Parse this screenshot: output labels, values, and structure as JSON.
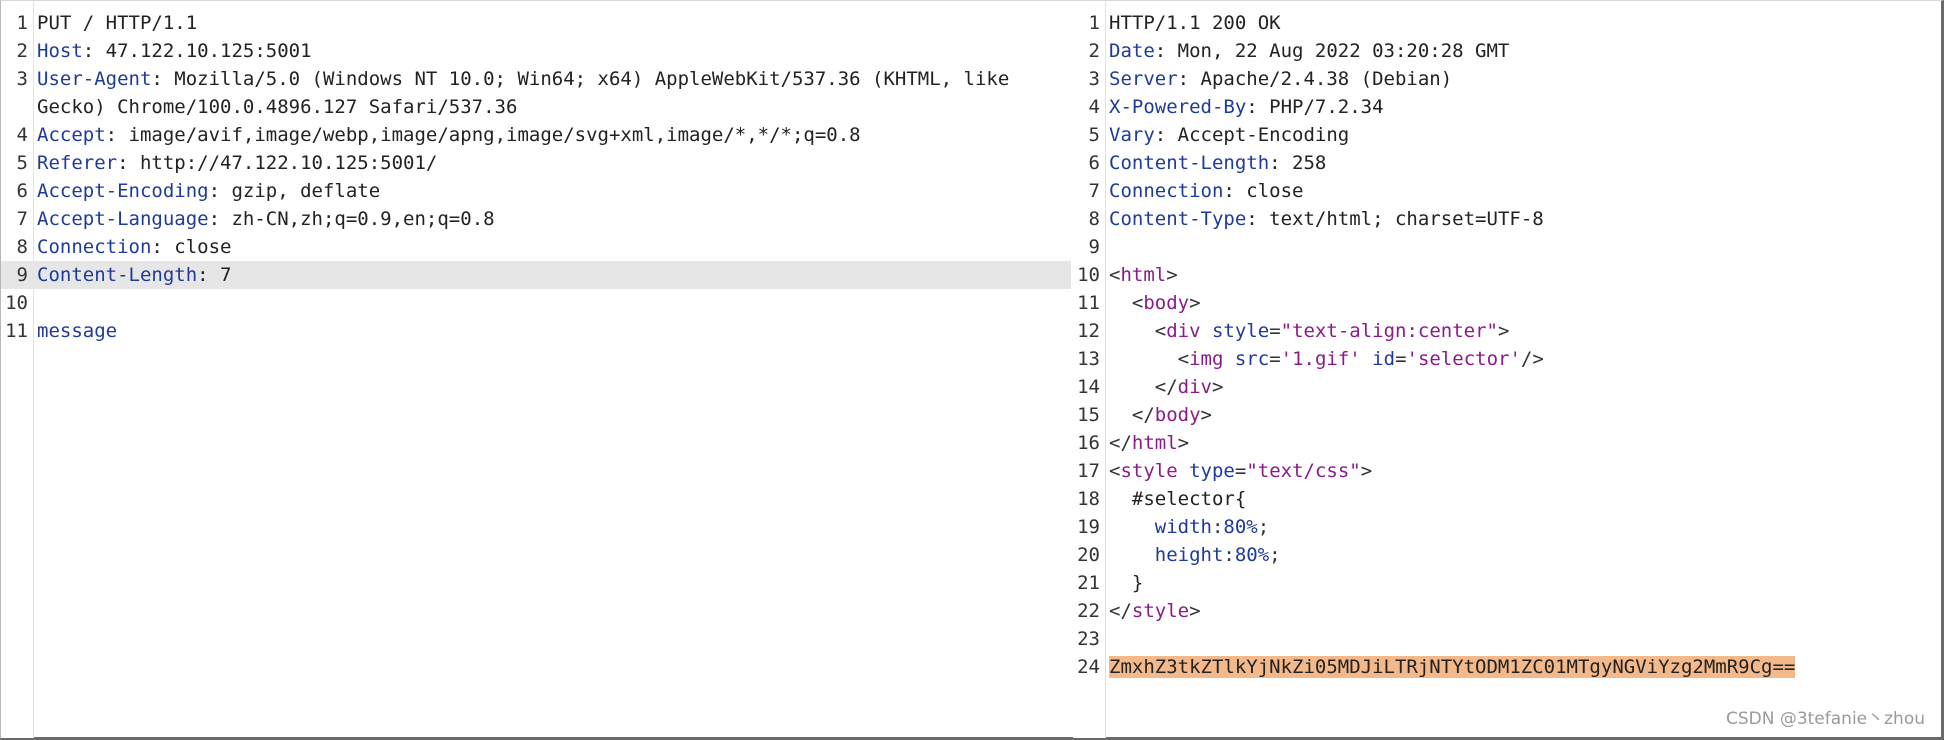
{
  "request": {
    "lines": [
      {
        "n": "1",
        "segs": [
          {
            "t": "PUT / HTTP/1.1",
            "c": ""
          }
        ]
      },
      {
        "n": "2",
        "segs": [
          {
            "t": "Host",
            "c": "hk"
          },
          {
            "t": ": 47.122.10.125:5001",
            "c": ""
          }
        ]
      },
      {
        "n": "3",
        "wrap": true,
        "segs": [
          {
            "t": "User-Agent",
            "c": "hk"
          },
          {
            "t": ": Mozilla/5.0 (Windows NT 10.0; Win64; x64) AppleWebKit/537.36 (KHTML, like Gecko) Chrome/100.0.4896.127 Safari/537.36",
            "c": ""
          }
        ]
      },
      {
        "n": "4",
        "segs": [
          {
            "t": "Accept",
            "c": "hk"
          },
          {
            "t": ": image/avif,image/webp,image/apng,image/svg+xml,image/*,*/*;q=0.8",
            "c": ""
          }
        ]
      },
      {
        "n": "5",
        "segs": [
          {
            "t": "Referer",
            "c": "hk"
          },
          {
            "t": ": http://47.122.10.125:5001/",
            "c": ""
          }
        ]
      },
      {
        "n": "6",
        "segs": [
          {
            "t": "Accept-Encoding",
            "c": "hk"
          },
          {
            "t": ": gzip, deflate",
            "c": ""
          }
        ]
      },
      {
        "n": "7",
        "segs": [
          {
            "t": "Accept-Language",
            "c": "hk"
          },
          {
            "t": ": zh-CN,zh;q=0.9,en;q=0.8",
            "c": ""
          }
        ]
      },
      {
        "n": "8",
        "segs": [
          {
            "t": "Connection",
            "c": "hk"
          },
          {
            "t": ": close",
            "c": ""
          }
        ]
      },
      {
        "n": "9",
        "hl": true,
        "segs": [
          {
            "t": "Content-Length",
            "c": "hk"
          },
          {
            "t": ": 7",
            "c": ""
          }
        ]
      },
      {
        "n": "10",
        "segs": []
      },
      {
        "n": "11",
        "segs": [
          {
            "t": "message",
            "c": "hk"
          }
        ]
      }
    ]
  },
  "response": {
    "lines": [
      {
        "n": "1",
        "segs": [
          {
            "t": "HTTP/1.1 200 OK",
            "c": ""
          }
        ]
      },
      {
        "n": "2",
        "segs": [
          {
            "t": "Date",
            "c": "hk"
          },
          {
            "t": ": Mon, 22 Aug 2022 03:20:28 GMT",
            "c": ""
          }
        ]
      },
      {
        "n": "3",
        "segs": [
          {
            "t": "Server",
            "c": "hk"
          },
          {
            "t": ": Apache/2.4.38 (Debian)",
            "c": ""
          }
        ]
      },
      {
        "n": "4",
        "segs": [
          {
            "t": "X-Powered-By",
            "c": "hk"
          },
          {
            "t": ": PHP/7.2.34",
            "c": ""
          }
        ]
      },
      {
        "n": "5",
        "segs": [
          {
            "t": "Vary",
            "c": "hk"
          },
          {
            "t": ": Accept-Encoding",
            "c": ""
          }
        ]
      },
      {
        "n": "6",
        "segs": [
          {
            "t": "Content-Length",
            "c": "hk"
          },
          {
            "t": ": 258",
            "c": ""
          }
        ]
      },
      {
        "n": "7",
        "segs": [
          {
            "t": "Connection",
            "c": "hk"
          },
          {
            "t": ": close",
            "c": ""
          }
        ]
      },
      {
        "n": "8",
        "segs": [
          {
            "t": "Content-Type",
            "c": "hk"
          },
          {
            "t": ": text/html; charset=UTF-8",
            "c": ""
          }
        ]
      },
      {
        "n": "9",
        "segs": []
      },
      {
        "n": "10",
        "segs": [
          {
            "t": "<",
            "c": "pn"
          },
          {
            "t": "html",
            "c": "tg"
          },
          {
            "t": ">",
            "c": "pn"
          }
        ]
      },
      {
        "n": "11",
        "segs": [
          {
            "t": "  <",
            "c": "pn"
          },
          {
            "t": "body",
            "c": "tg"
          },
          {
            "t": ">",
            "c": "pn"
          }
        ]
      },
      {
        "n": "12",
        "segs": [
          {
            "t": "    <",
            "c": "pn"
          },
          {
            "t": "div",
            "c": "tg"
          },
          {
            "t": " ",
            "c": ""
          },
          {
            "t": "style",
            "c": "at"
          },
          {
            "t": "=",
            "c": "pn"
          },
          {
            "t": "\"text-align:center\"",
            "c": "st"
          },
          {
            "t": ">",
            "c": "pn"
          }
        ]
      },
      {
        "n": "13",
        "segs": [
          {
            "t": "      <",
            "c": "pn"
          },
          {
            "t": "img",
            "c": "tg"
          },
          {
            "t": " ",
            "c": ""
          },
          {
            "t": "src",
            "c": "at"
          },
          {
            "t": "=",
            "c": "pn"
          },
          {
            "t": "'1.gif'",
            "c": "st"
          },
          {
            "t": " ",
            "c": ""
          },
          {
            "t": "id",
            "c": "at"
          },
          {
            "t": "=",
            "c": "pn"
          },
          {
            "t": "'selector'",
            "c": "st"
          },
          {
            "t": "/>",
            "c": "pn"
          }
        ]
      },
      {
        "n": "14",
        "segs": [
          {
            "t": "    </",
            "c": "pn"
          },
          {
            "t": "div",
            "c": "tg"
          },
          {
            "t": ">",
            "c": "pn"
          }
        ]
      },
      {
        "n": "15",
        "segs": [
          {
            "t": "  </",
            "c": "pn"
          },
          {
            "t": "body",
            "c": "tg"
          },
          {
            "t": ">",
            "c": "pn"
          }
        ]
      },
      {
        "n": "16",
        "segs": [
          {
            "t": "</",
            "c": "pn"
          },
          {
            "t": "html",
            "c": "tg"
          },
          {
            "t": ">",
            "c": "pn"
          }
        ]
      },
      {
        "n": "17",
        "segs": [
          {
            "t": "<",
            "c": "pn"
          },
          {
            "t": "style",
            "c": "tg"
          },
          {
            "t": " ",
            "c": ""
          },
          {
            "t": "type",
            "c": "at"
          },
          {
            "t": "=",
            "c": "pn"
          },
          {
            "t": "\"text/css\"",
            "c": "st"
          },
          {
            "t": ">",
            "c": "pn"
          }
        ]
      },
      {
        "n": "18",
        "segs": [
          {
            "t": "  #selector{",
            "c": ""
          }
        ]
      },
      {
        "n": "19",
        "segs": [
          {
            "t": "    width",
            "c": "hk"
          },
          {
            "t": ":",
            "c": "pn"
          },
          {
            "t": "80%",
            "c": "nm"
          },
          {
            "t": ";",
            "c": "pn"
          }
        ]
      },
      {
        "n": "20",
        "segs": [
          {
            "t": "    height",
            "c": "hk"
          },
          {
            "t": ":",
            "c": "pn"
          },
          {
            "t": "80%",
            "c": "nm"
          },
          {
            "t": ";",
            "c": "pn"
          }
        ]
      },
      {
        "n": "21",
        "segs": [
          {
            "t": "  }",
            "c": ""
          }
        ]
      },
      {
        "n": "22",
        "segs": [
          {
            "t": "</",
            "c": "pn"
          },
          {
            "t": "style",
            "c": "tg"
          },
          {
            "t": ">",
            "c": "pn"
          }
        ]
      },
      {
        "n": "23",
        "segs": []
      },
      {
        "n": "24",
        "segs": [
          {
            "t": "ZmxhZ3tkZTlkYjNkZi05MDJiLTRjNTYtODM1ZC01MTgyNGViYzg2MmR9Cg==",
            "c": "flag"
          }
        ]
      }
    ]
  },
  "splitter": {
    "glyph": "⋮"
  },
  "watermark": "CSDN @3tefanie丶zhou",
  "colors": {
    "header_key": "#1f3a99",
    "tag": "#8b1a8b",
    "highlight_row": "#e6e6e6",
    "flag_highlight": "#f4b98a"
  }
}
